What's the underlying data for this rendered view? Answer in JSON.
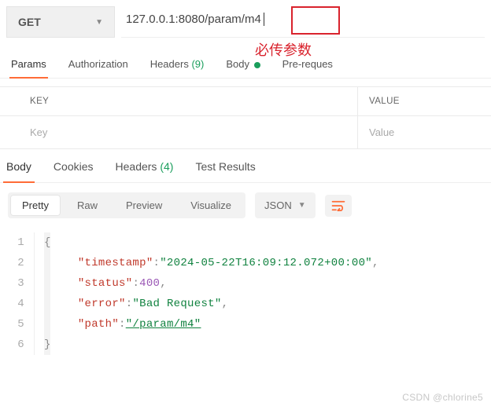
{
  "request": {
    "method": "GET",
    "url_prefix": "127.0.0.1:8080/param/",
    "url_highlight": "m4"
  },
  "annotation": {
    "label": "必传参数"
  },
  "req_tabs": {
    "params": "Params",
    "authorization": "Authorization",
    "headers_label": "Headers",
    "headers_count": "(9)",
    "body": "Body",
    "prerequest": "Pre-reques"
  },
  "kv": {
    "key_header": "KEY",
    "value_header": "VALUE",
    "key_placeholder": "Key",
    "value_placeholder": "Value"
  },
  "resp_tabs": {
    "body": "Body",
    "cookies": "Cookies",
    "headers_label": "Headers",
    "headers_count": "(4)",
    "test_results": "Test Results"
  },
  "view_modes": {
    "pretty": "Pretty",
    "raw": "Raw",
    "preview": "Preview",
    "visualize": "Visualize",
    "lang": "JSON"
  },
  "response_body": {
    "timestamp_key": "\"timestamp\"",
    "timestamp_val": "\"2024-05-22T16:09:12.072+00:00\"",
    "status_key": "\"status\"",
    "status_val": "400",
    "error_key": "\"error\"",
    "error_val": "\"Bad Request\"",
    "path_key": "\"path\"",
    "path_val": "\"/param/m4\""
  },
  "watermark": "CSDN @chlorine5"
}
